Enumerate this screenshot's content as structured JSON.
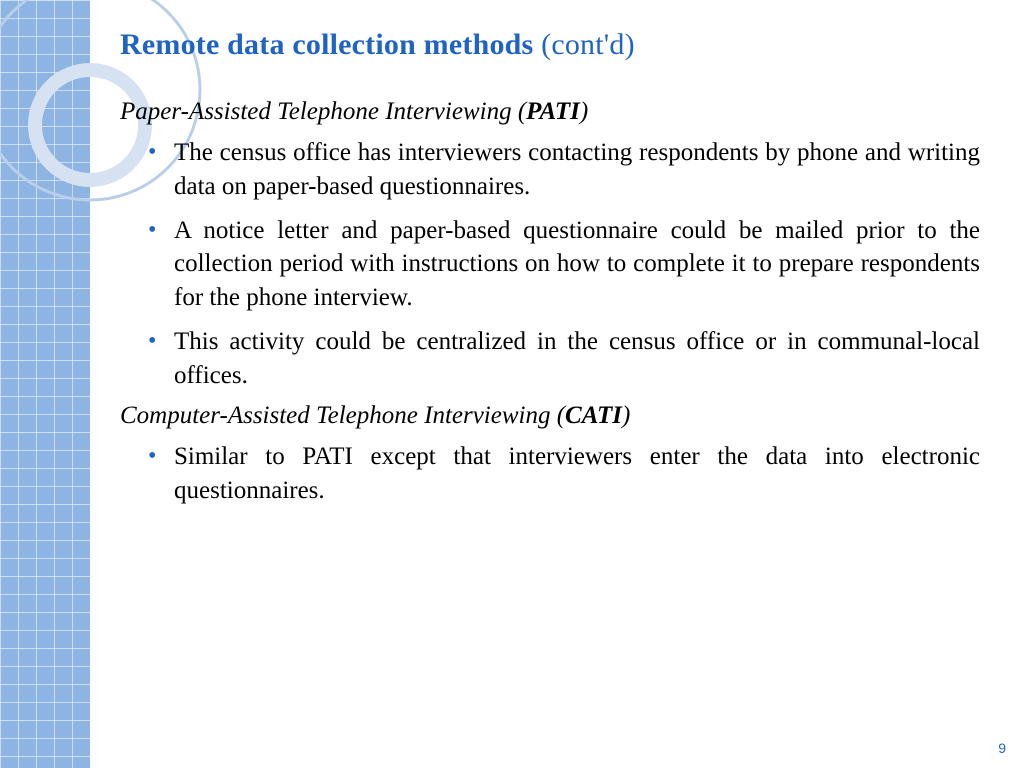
{
  "title": {
    "main": "Remote data collection methods ",
    "contd": "(cont'd)"
  },
  "section1": {
    "heading_pre": "Paper-Assisted Telephone Interviewing (",
    "acronym": "PATI",
    "heading_post": ")",
    "bullets": [
      "The census office has interviewers contacting respondents by phone and writing data on paper-based questionnaires.",
      "A notice letter and paper-based questionnaire could be mailed prior to the collection period with instructions on how to complete it to prepare respondents for the phone interview.",
      "This activity could be centralized in the census office or in communal-local offices."
    ]
  },
  "section2": {
    "heading_pre": "Computer-Assisted Telephone Interviewing (",
    "acronym": "CATI",
    "heading_post": ")",
    "bullets": [
      "Similar to PATI except that interviewers enter the data into electronic questionnaires."
    ]
  },
  "page_number": "9"
}
